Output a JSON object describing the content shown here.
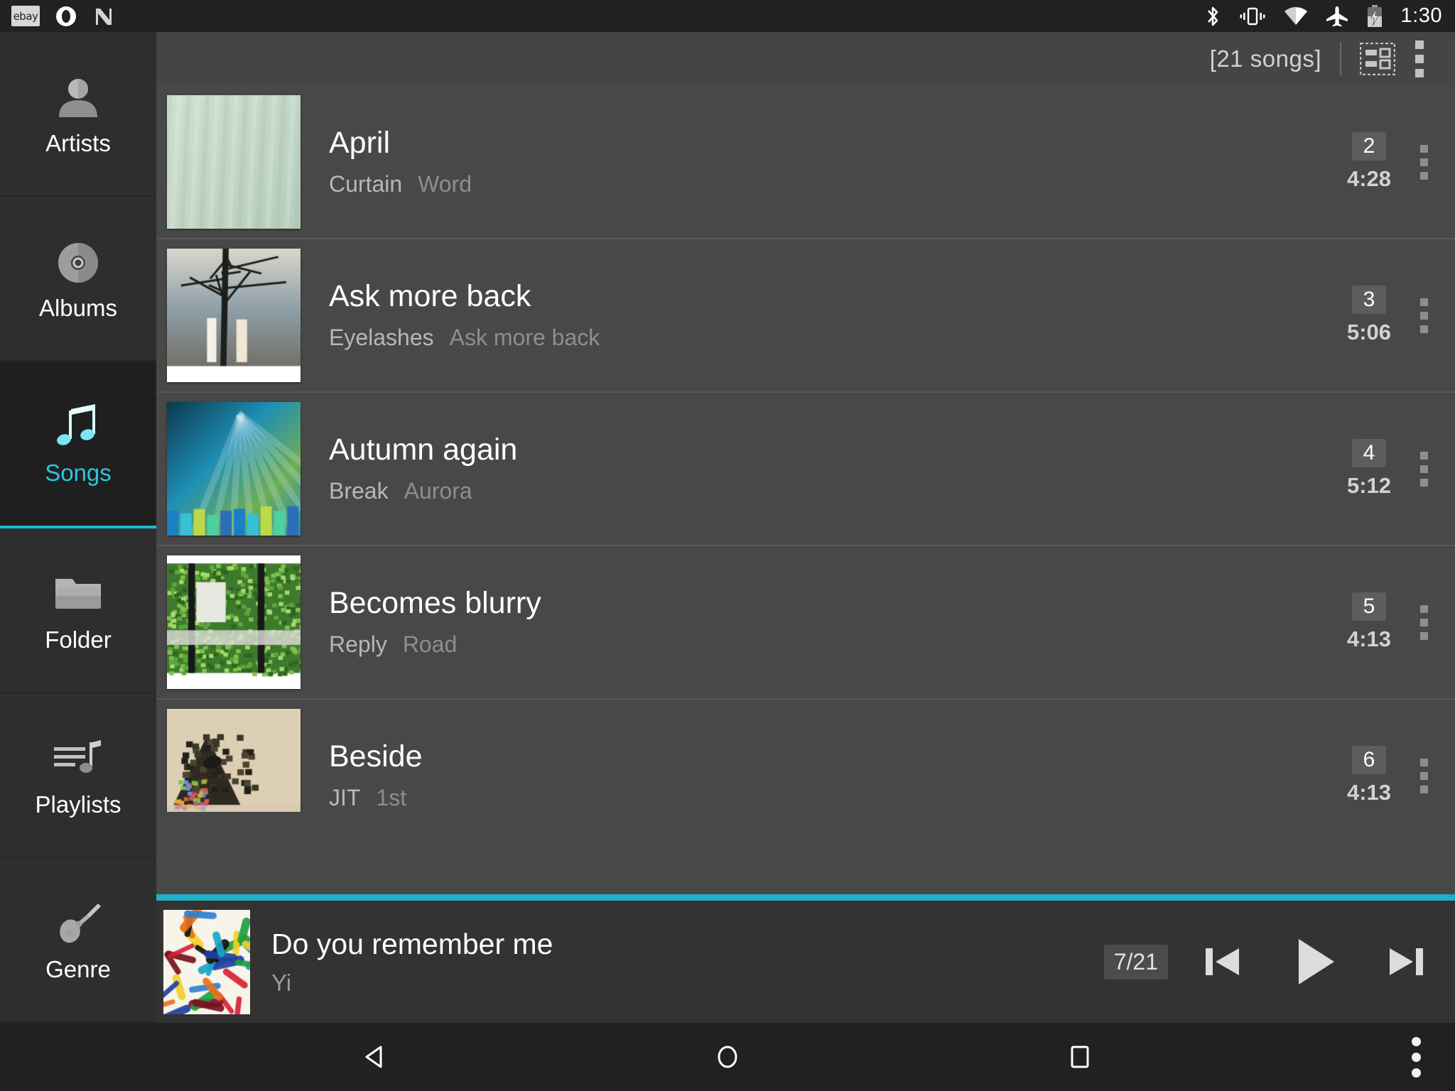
{
  "statusbar": {
    "time": "1:30",
    "left_icons": [
      "ebay-icon",
      "opera-icon",
      "nova-icon"
    ],
    "ebay_label": "ebay",
    "right_icons": [
      "bluetooth-icon",
      "vibrate-icon",
      "wifi-icon",
      "airplane-icon",
      "battery-charging-icon"
    ]
  },
  "sidebar": {
    "items": [
      {
        "label": "Artists",
        "icon": "person-icon",
        "active": false
      },
      {
        "label": "Albums",
        "icon": "disc-icon",
        "active": false
      },
      {
        "label": "Songs",
        "icon": "music-note-icon",
        "active": true
      },
      {
        "label": "Folder",
        "icon": "folder-icon",
        "active": false
      },
      {
        "label": "Playlists",
        "icon": "playlist-icon",
        "active": false
      },
      {
        "label": "Genre",
        "icon": "guitar-icon",
        "active": false
      }
    ]
  },
  "toolbar": {
    "song_count": "[21 songs]",
    "layout_icon": "grid-layout-icon",
    "overflow_icon": "overflow-menu-icon"
  },
  "songs": [
    {
      "title": "April",
      "artist": "Curtain",
      "album": "Word",
      "track": "2",
      "duration": "4:28",
      "art": "curtain"
    },
    {
      "title": "Ask more back",
      "artist": "Eyelashes",
      "album": "Ask more back",
      "track": "3",
      "duration": "5:06",
      "art": "tree"
    },
    {
      "title": "Autumn again",
      "artist": "Break",
      "album": "Aurora",
      "track": "4",
      "duration": "5:12",
      "art": "aurora"
    },
    {
      "title": "Becomes blurry",
      "artist": "Reply",
      "album": "Road",
      "track": "5",
      "duration": "4:13",
      "art": "green"
    },
    {
      "title": "Beside",
      "artist": "JIT",
      "album": "1st",
      "track": "6",
      "duration": "4:13",
      "art": "collage"
    },
    {
      "title": "",
      "artist": "",
      "album": "",
      "track": "",
      "duration": "",
      "art": "crayon"
    }
  ],
  "now_playing": {
    "title": "Do you remember me",
    "artist": "Yi",
    "position": "7/21",
    "prev_icon": "skip-previous-icon",
    "play_icon": "play-icon",
    "next_icon": "skip-next-icon",
    "art": "crayon"
  },
  "navbar": {
    "back_icon": "back-triangle-icon",
    "home_icon": "home-circle-icon",
    "recents_icon": "recents-square-icon",
    "more_icon": "nav-overflow-icon"
  },
  "colors": {
    "accent": "#1eb8d0",
    "list_bg": "#484848",
    "sidebar_bg": "#2e2e2e",
    "statusbar_bg": "#212121",
    "nowbar_bg": "#333333"
  }
}
